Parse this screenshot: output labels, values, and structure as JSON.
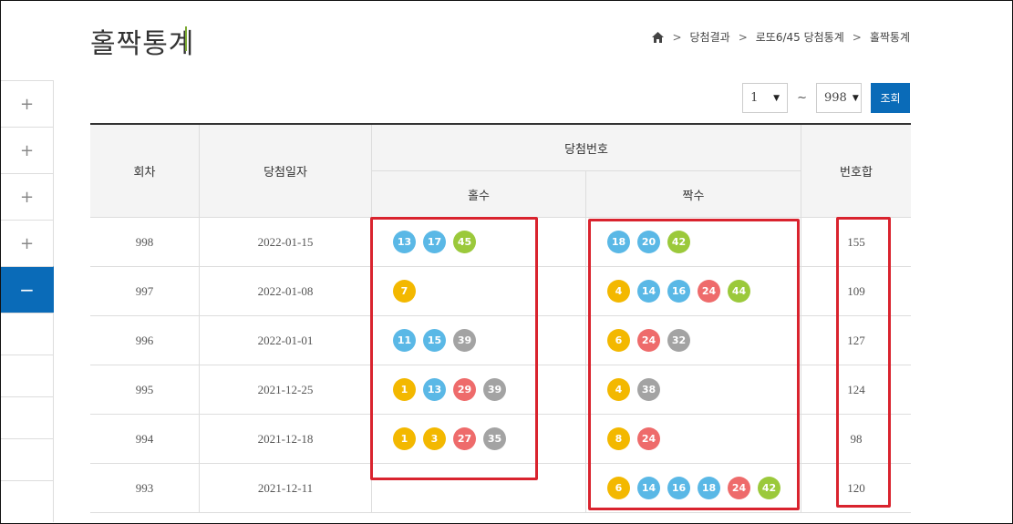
{
  "header": {
    "title": "홀짝통계",
    "breadcrumb": [
      "당첨결과",
      "로또6/45 당첨통계",
      "홀짝통계"
    ]
  },
  "sidebar": {
    "items": [
      "+",
      "+",
      "+",
      "+",
      "−"
    ]
  },
  "filter": {
    "from": "1",
    "tilde": "~",
    "to": "998",
    "search_label": "조회"
  },
  "table": {
    "headers": {
      "round": "회차",
      "date": "당첨일자",
      "numbers": "당첨번호",
      "odd": "홀수",
      "even": "짝수",
      "sum": "번호합"
    },
    "rows": [
      {
        "round": "998",
        "date": "2022-01-15",
        "odd": [
          13,
          17,
          45
        ],
        "even": [
          18,
          20,
          42
        ],
        "sum": "155"
      },
      {
        "round": "997",
        "date": "2022-01-08",
        "odd": [
          7
        ],
        "even": [
          4,
          14,
          16,
          24,
          44
        ],
        "sum": "109"
      },
      {
        "round": "996",
        "date": "2022-01-01",
        "odd": [
          11,
          15,
          39
        ],
        "even": [
          6,
          24,
          32
        ],
        "sum": "127"
      },
      {
        "round": "995",
        "date": "2021-12-25",
        "odd": [
          1,
          13,
          29,
          39
        ],
        "even": [
          4,
          38
        ],
        "sum": "124"
      },
      {
        "round": "994",
        "date": "2021-12-18",
        "odd": [
          1,
          3,
          27,
          35
        ],
        "even": [
          8,
          24
        ],
        "sum": "98"
      },
      {
        "round": "993",
        "date": "2021-12-11",
        "odd": [],
        "even": [
          6,
          14,
          16,
          18,
          24,
          42
        ],
        "sum": "120"
      }
    ]
  },
  "colors": {
    "accent": "#0a6bb8",
    "highlight": "#d9232e",
    "ball_1_10": "#f3b800",
    "ball_11_20": "#5ab8e6",
    "ball_21_30": "#ee6b6b",
    "ball_31_40": "#a3a3a3",
    "ball_41_45": "#9bc93b"
  }
}
